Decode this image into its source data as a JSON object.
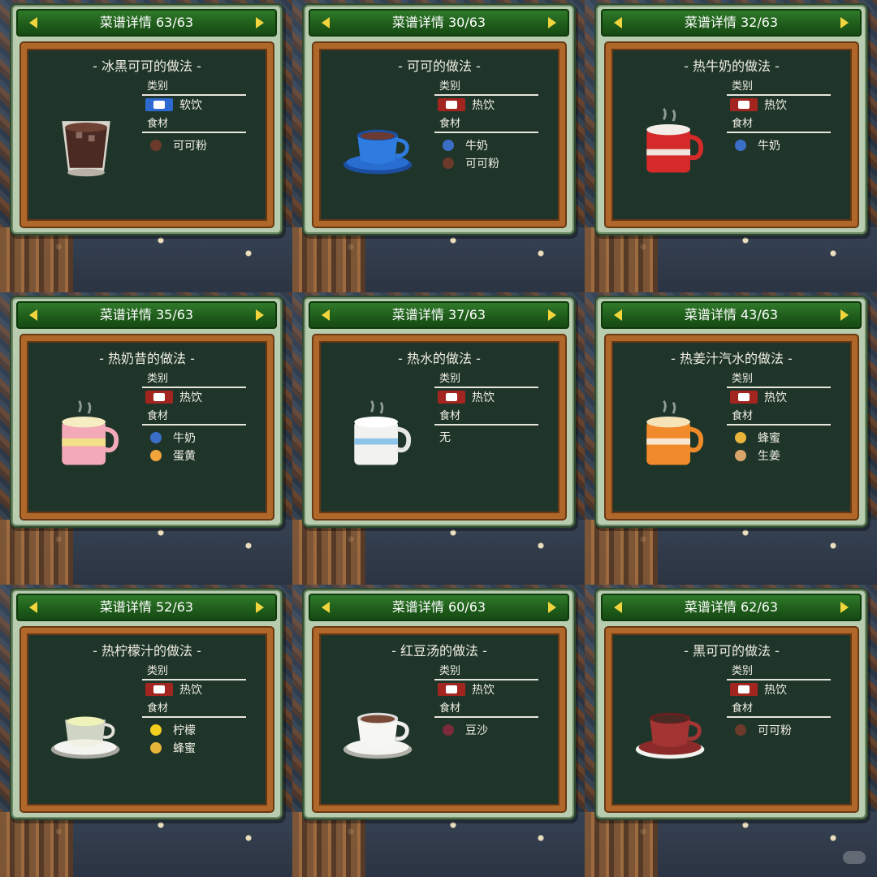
{
  "header_prefix": "菜谱详情",
  "labels": {
    "category": "类别",
    "ingredients": "食材"
  },
  "colors": {
    "title_bar": "#1e5b1a",
    "board": "#1f3529",
    "frame": "#b0682a",
    "arrow": "#f2d53c"
  },
  "cards": [
    {
      "counter": "菜谱详情 63/63",
      "title": "- 冰黑可可的做法 -",
      "category": "软饮",
      "category_icon": "cold-drink-icon",
      "ingredients": [
        {
          "name": "可可粉",
          "icon": "cocoa-powder-icon",
          "color": "#6b3a2a"
        }
      ],
      "dish": "iced-cocoa-glass"
    },
    {
      "counter": "菜谱详情 30/63",
      "title": "- 可可的做法 -",
      "category": "热饮",
      "category_icon": "hot-drink-icon",
      "ingredients": [
        {
          "name": "牛奶",
          "icon": "milk-carton-icon",
          "color": "#3b6fc7"
        },
        {
          "name": "可可粉",
          "icon": "cocoa-powder-icon",
          "color": "#6b3a2a"
        }
      ],
      "dish": "blue-cup"
    },
    {
      "counter": "菜谱详情 32/63",
      "title": "- 热牛奶的做法 -",
      "category": "热饮",
      "category_icon": "hot-drink-icon",
      "ingredients": [
        {
          "name": "牛奶",
          "icon": "milk-carton-icon",
          "color": "#3b6fc7"
        }
      ],
      "dish": "red-mug"
    },
    {
      "counter": "菜谱详情 35/63",
      "title": "- 热奶昔的做法 -",
      "category": "热饮",
      "category_icon": "hot-drink-icon",
      "ingredients": [
        {
          "name": "牛奶",
          "icon": "milk-carton-icon",
          "color": "#3b6fc7"
        },
        {
          "name": "蛋黄",
          "icon": "egg-yolk-icon",
          "color": "#f0a43a"
        }
      ],
      "dish": "pink-mug"
    },
    {
      "counter": "菜谱详情 37/63",
      "title": "- 热水的做法 -",
      "category": "热饮",
      "category_icon": "hot-drink-icon",
      "ingredients": [],
      "none_text": "无",
      "dish": "white-blue-mug"
    },
    {
      "counter": "菜谱详情 43/63",
      "title": "- 热姜汁汽水的做法 -",
      "category": "热饮",
      "category_icon": "hot-drink-icon",
      "ingredients": [
        {
          "name": "蜂蜜",
          "icon": "honey-pot-icon",
          "color": "#e8b43a"
        },
        {
          "name": "生姜",
          "icon": "ginger-icon",
          "color": "#d9a46a"
        }
      ],
      "dish": "orange-mug"
    },
    {
      "counter": "菜谱详情 52/63",
      "title": "- 热柠檬汁的做法 -",
      "category": "热饮",
      "category_icon": "hot-drink-icon",
      "ingredients": [
        {
          "name": "柠檬",
          "icon": "lemon-icon",
          "color": "#f2cf1e"
        },
        {
          "name": "蜂蜜",
          "icon": "honey-pot-icon",
          "color": "#e8b43a"
        }
      ],
      "dish": "glass-cup-saucer"
    },
    {
      "counter": "菜谱详情 60/63",
      "title": "- 红豆汤的做法 -",
      "category": "热饮",
      "category_icon": "hot-drink-icon",
      "ingredients": [
        {
          "name": "豆沙",
          "icon": "bean-paste-icon",
          "color": "#7a2a3a"
        }
      ],
      "dish": "white-cup-saucer"
    },
    {
      "counter": "菜谱详情 62/63",
      "title": "- 黑可可的做法 -",
      "category": "热饮",
      "category_icon": "hot-drink-icon",
      "ingredients": [
        {
          "name": "可可粉",
          "icon": "cocoa-powder-icon",
          "color": "#6b3a2a"
        }
      ],
      "dish": "maroon-cup-saucer"
    }
  ]
}
